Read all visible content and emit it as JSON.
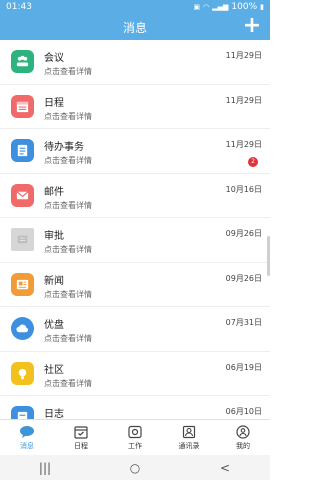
{
  "status": {
    "time": "01:43",
    "battery": "100%"
  },
  "header": {
    "title": "消息",
    "add_label": "+"
  },
  "items": [
    {
      "name": "会议",
      "sub": "点击查看详情",
      "date": "11月29日",
      "color": "#2DB37D",
      "icon": "meeting-icon"
    },
    {
      "name": "日程",
      "sub": "点击查看详情",
      "date": "11月29日",
      "color": "#F06A6A",
      "icon": "calendar-icon"
    },
    {
      "name": "待办事务",
      "sub": "点击查看详情",
      "date": "11月29日",
      "color": "#3D8FE0",
      "icon": "todo-icon",
      "badge": "2"
    },
    {
      "name": "邮件",
      "sub": "点击查看详情",
      "date": "10月16日",
      "color": "#F06A6A",
      "icon": "mail-icon"
    },
    {
      "name": "审批",
      "sub": "点击查看详情",
      "date": "09月26日",
      "color": "#BDBDBD",
      "icon": "approval-icon"
    },
    {
      "name": "新闻",
      "sub": "点击查看详情",
      "date": "09月26日",
      "color": "#F29C38",
      "icon": "news-icon"
    },
    {
      "name": "优盘",
      "sub": "点击查看详情",
      "date": "07月31日",
      "color": "#3D8FE0",
      "icon": "cloud-icon"
    },
    {
      "name": "社区",
      "sub": "点击查看详情",
      "date": "06月19日",
      "color": "#F3C11E",
      "icon": "community-icon"
    },
    {
      "name": "日志",
      "sub": "",
      "date": "06月10日",
      "color": "#3D8FE0",
      "icon": "log-icon"
    }
  ],
  "tabs": [
    {
      "label": "消息",
      "icon": "chat-icon",
      "active": true
    },
    {
      "label": "日程",
      "icon": "calendar-tab-icon",
      "active": false
    },
    {
      "label": "工作",
      "icon": "work-icon",
      "active": false
    },
    {
      "label": "通讯录",
      "icon": "contacts-icon",
      "active": false
    },
    {
      "label": "我的",
      "icon": "profile-icon",
      "active": false
    }
  ],
  "navbar": {
    "recents": "|||",
    "home": "○",
    "back": "<"
  }
}
